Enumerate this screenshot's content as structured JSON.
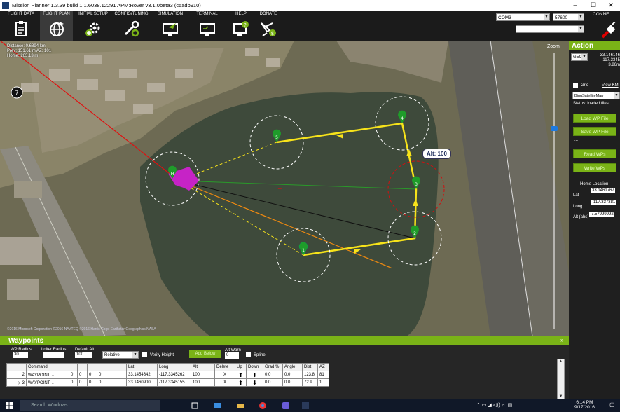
{
  "window": {
    "title": "Mission Planner 1.3.39 build 1.1.6038.12291 APM:Rover v3.1.0beta3 (c5adb910)",
    "minimize": "–",
    "maximize": "☐",
    "close": "✕"
  },
  "toolbar": {
    "items": [
      {
        "label": "FLIGHT DATA",
        "icon": "clipboard-icon"
      },
      {
        "label": "FLIGHT PLAN",
        "icon": "globe-icon"
      },
      {
        "label": "INITIAL SETUP",
        "icon": "gear-plus-icon"
      },
      {
        "label": "CONFIG/TUNING",
        "icon": "wrench-icon"
      },
      {
        "label": "SIMULATION",
        "icon": "monitor-plane-icon"
      },
      {
        "label": "TERMINAL",
        "icon": "terminal-icon"
      },
      {
        "label": "HELP",
        "icon": "help-monitor-icon"
      },
      {
        "label": "DONATE",
        "icon": "plane-dollar-icon"
      }
    ],
    "com_port": "COM3",
    "baud": "57600",
    "connect_label": "CONNE"
  },
  "map": {
    "info_distance": "Distance: 0.6894 km",
    "info_prev": "Prev: 151.61 m AZ: 101",
    "info_home": "Home: 263.13 m",
    "zoom_label": "Zoom",
    "alt_popup": "Alt: 100",
    "attribution": "©2016 Microsoft Corporation  ©2016 NAVTEQ  ©2016 Harris Corp, Earthstar Geographics  NASA",
    "waypoint_labels": [
      "1",
      "2",
      "3",
      "4",
      "5",
      "H"
    ],
    "compass": "7"
  },
  "action": {
    "title": "Action",
    "coord_mode": "GEO",
    "coord_lat": "33.146146",
    "coord_lon": "-117.3345",
    "coord_alt": "3.86m",
    "grid_label": "Grid",
    "view_kml": "View KM",
    "map_provider": "BingSatelliteMap",
    "status": "Status: loaded tiles",
    "load_wp": "Load WP File",
    "save_wp": "Save WP File",
    "read_wps": "Read WPs",
    "write_wps": "Write WPs",
    "home_title": "Home Location",
    "home_lat_label": "Lat",
    "home_lat": "33.1461767",
    "home_long_label": "Long",
    "home_long": "-117.337381",
    "home_alt_label": "Alt (abs)",
    "home_alt": "-7.57999992",
    "ellipsis": "..."
  },
  "waypoints": {
    "title": "Waypoints",
    "wp_radius_label": "WP Radius",
    "wp_radius": "30",
    "loiter_radius_label": "Loiter Radius",
    "default_alt_label": "Default Alt",
    "default_alt": "100",
    "frame": "Relative",
    "verify_height": "Verify Height",
    "add_below": "Add Below",
    "alt_warn_label": "Alt Warn",
    "alt_warn": "0",
    "spline": "Spline",
    "columns": [
      "",
      "Command",
      "",
      "",
      "",
      "",
      "Lat",
      "Long",
      "Alt",
      "Delete",
      "Up",
      "Down",
      "Grad %",
      "Angle",
      "Dist",
      "AZ"
    ],
    "rows": [
      {
        "num": "2",
        "marker": "",
        "cmd": "WAYPOINT",
        "p1": "0",
        "p2": "0",
        "p3": "0",
        "p4": "0",
        "lat": "33.1454342",
        "long": "-117.3345262",
        "alt": "100",
        "del": "X",
        "grad": "0.0",
        "angle": "0.0",
        "dist": "123.8",
        "az": "81"
      },
      {
        "num": "3",
        "marker": "▷",
        "cmd": "WAYPOINT",
        "p1": "0",
        "p2": "0",
        "p3": "0",
        "p4": "0",
        "lat": "33.1460900",
        "long": "-117.3345155",
        "alt": "100",
        "del": "X",
        "grad": "0.0",
        "angle": "0.0",
        "dist": "72.9",
        "az": "1"
      }
    ],
    "expand": "»"
  },
  "taskbar": {
    "search_placeholder": "Search Windows",
    "time": "6:14 PM",
    "date": "9/17/2016"
  }
}
